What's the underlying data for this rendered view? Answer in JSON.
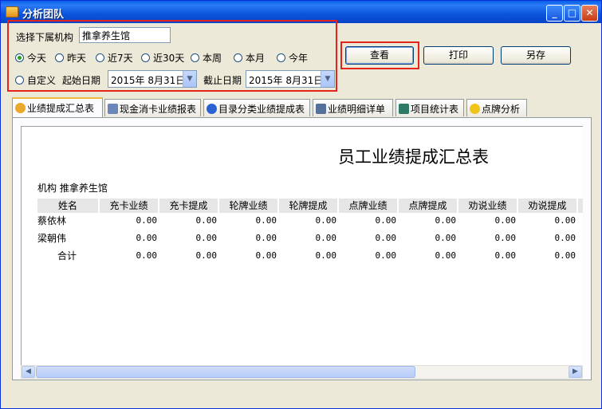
{
  "window": {
    "title": "分析团队",
    "minimize": "_",
    "maximize": "□",
    "close": "✕"
  },
  "filter": {
    "org_label": "选择下属机构",
    "org_value": "推拿养生馆",
    "periods": [
      "今天",
      "昨天",
      "近7天",
      "近30天",
      "本周",
      "本月",
      "今年"
    ],
    "selected_period": "今天",
    "custom_label": "自定义",
    "start_label": "起始日期",
    "start_date": "2015年  8月31日",
    "end_label": "截止日期",
    "end_date": "2015年  8月31日"
  },
  "buttons": {
    "view": "查看",
    "print": "打印",
    "save_as": "另存"
  },
  "tabs": [
    {
      "label": "业绩提成汇总表",
      "icon": "summary-icon",
      "color": "#e9a92b"
    },
    {
      "label": "现金消卡业绩报表",
      "icon": "report-icon",
      "color": "#6b86b8"
    },
    {
      "label": "目录分类业绩提成表",
      "icon": "info-icon",
      "color": "#2a62d4"
    },
    {
      "label": "业绩明细详单",
      "icon": "tools-icon",
      "color": "#557099"
    },
    {
      "label": "项目统计表",
      "icon": "grid-icon",
      "color": "#2d7b66"
    },
    {
      "label": "点牌分析",
      "icon": "smiley-icon",
      "color": "#f0c419"
    }
  ],
  "report": {
    "title": "员工业绩提成汇总表",
    "org_line": "机构 推拿养生馆",
    "columns": [
      "姓名",
      "充卡业绩",
      "充卡提成",
      "轮牌业绩",
      "轮牌提成",
      "点牌业绩",
      "点牌提成",
      "劝说业绩",
      "劝说提成",
      "销"
    ],
    "rows": [
      {
        "name": "蔡依林",
        "values": [
          "0.00",
          "0.00",
          "0.00",
          "0.00",
          "0.00",
          "0.00",
          "0.00",
          "0.00"
        ]
      },
      {
        "name": "梁朝伟",
        "values": [
          "0.00",
          "0.00",
          "0.00",
          "0.00",
          "0.00",
          "0.00",
          "0.00",
          "0.00"
        ]
      },
      {
        "name": "合计",
        "values": [
          "0.00",
          "0.00",
          "0.00",
          "0.00",
          "0.00",
          "0.00",
          "0.00",
          "0.00"
        ]
      }
    ]
  },
  "scrollbar": {
    "left_arrow": "◀",
    "right_arrow": "▶",
    "dropdown_arrow": "▼"
  }
}
